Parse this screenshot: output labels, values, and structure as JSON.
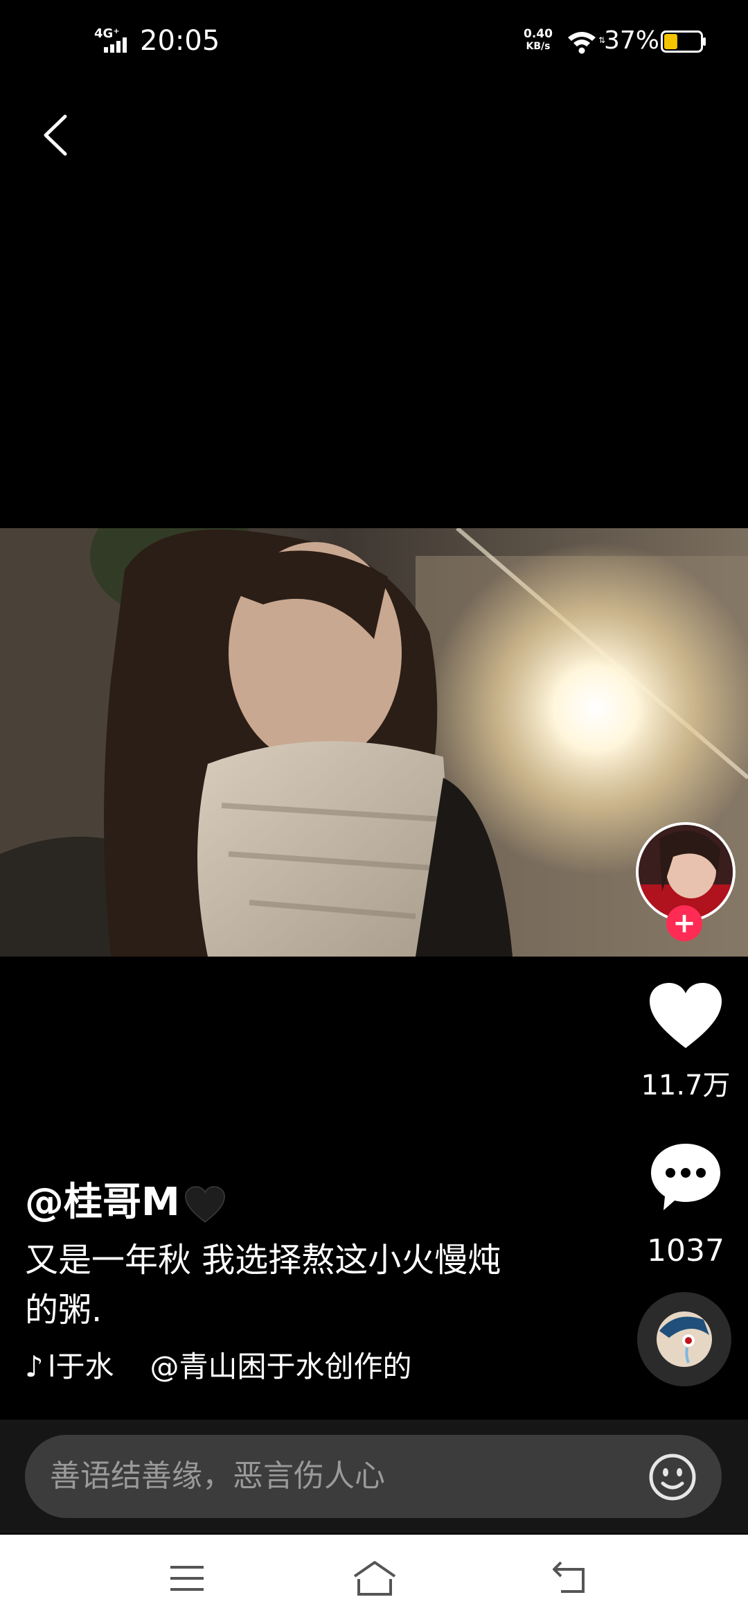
{
  "status_bar": {
    "network": "4G⁺",
    "time": "20:05",
    "speed_value": "0.40",
    "speed_unit": "KB/s",
    "battery_percent": "37%",
    "battery_level": 0.37
  },
  "video": {
    "author_handle": "@桂哥M",
    "caption": "又是一年秋 我选择熬这小火慢炖的粥.",
    "music_title": "l于水",
    "music_credit": "@青山困于水创作的"
  },
  "actions": {
    "like_count": "11.7万",
    "comment_count": "1037",
    "follow_label": "+"
  },
  "comment_bar": {
    "placeholder": "善语结善缘，恶言伤人心"
  },
  "colors": {
    "accent": "#fe2c55",
    "battery": "#f5c400"
  },
  "icons": {
    "back": "chevron-left-icon",
    "like": "heart-icon",
    "comment": "comment-bubble-icon",
    "emoji": "smiley-icon",
    "nav_menu": "menu-icon",
    "nav_home": "home-icon",
    "nav_back": "back-icon"
  }
}
